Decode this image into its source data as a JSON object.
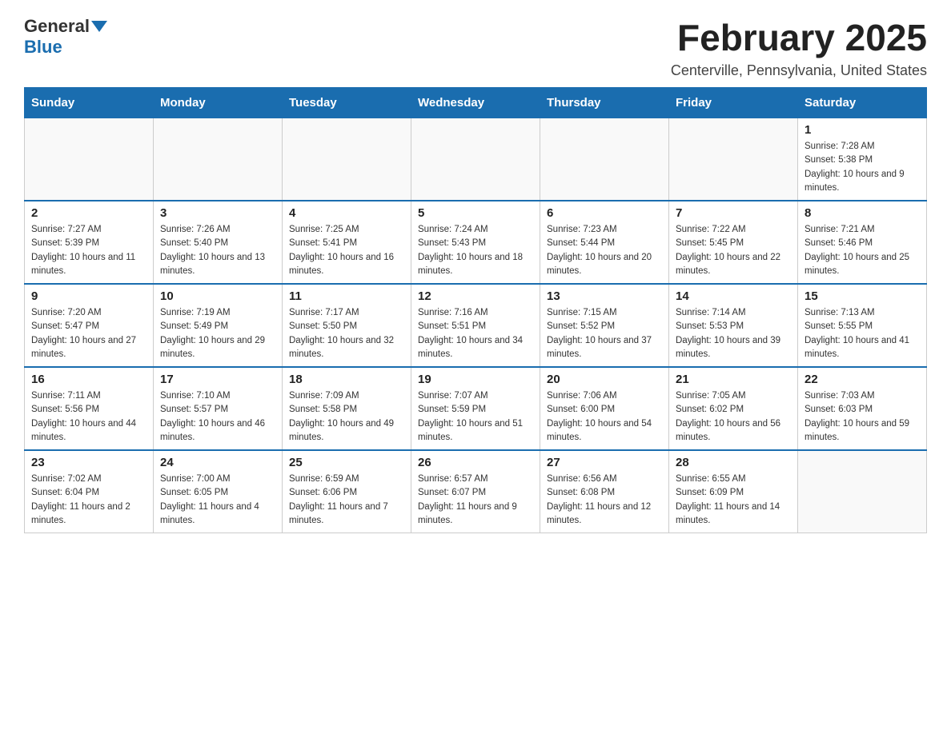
{
  "logo": {
    "general": "General",
    "blue": "Blue"
  },
  "header": {
    "month_year": "February 2025",
    "location": "Centerville, Pennsylvania, United States"
  },
  "days_of_week": [
    "Sunday",
    "Monday",
    "Tuesday",
    "Wednesday",
    "Thursday",
    "Friday",
    "Saturday"
  ],
  "weeks": [
    [
      {
        "day": "",
        "info": ""
      },
      {
        "day": "",
        "info": ""
      },
      {
        "day": "",
        "info": ""
      },
      {
        "day": "",
        "info": ""
      },
      {
        "day": "",
        "info": ""
      },
      {
        "day": "",
        "info": ""
      },
      {
        "day": "1",
        "info": "Sunrise: 7:28 AM\nSunset: 5:38 PM\nDaylight: 10 hours and 9 minutes."
      }
    ],
    [
      {
        "day": "2",
        "info": "Sunrise: 7:27 AM\nSunset: 5:39 PM\nDaylight: 10 hours and 11 minutes."
      },
      {
        "day": "3",
        "info": "Sunrise: 7:26 AM\nSunset: 5:40 PM\nDaylight: 10 hours and 13 minutes."
      },
      {
        "day": "4",
        "info": "Sunrise: 7:25 AM\nSunset: 5:41 PM\nDaylight: 10 hours and 16 minutes."
      },
      {
        "day": "5",
        "info": "Sunrise: 7:24 AM\nSunset: 5:43 PM\nDaylight: 10 hours and 18 minutes."
      },
      {
        "day": "6",
        "info": "Sunrise: 7:23 AM\nSunset: 5:44 PM\nDaylight: 10 hours and 20 minutes."
      },
      {
        "day": "7",
        "info": "Sunrise: 7:22 AM\nSunset: 5:45 PM\nDaylight: 10 hours and 22 minutes."
      },
      {
        "day": "8",
        "info": "Sunrise: 7:21 AM\nSunset: 5:46 PM\nDaylight: 10 hours and 25 minutes."
      }
    ],
    [
      {
        "day": "9",
        "info": "Sunrise: 7:20 AM\nSunset: 5:47 PM\nDaylight: 10 hours and 27 minutes."
      },
      {
        "day": "10",
        "info": "Sunrise: 7:19 AM\nSunset: 5:49 PM\nDaylight: 10 hours and 29 minutes."
      },
      {
        "day": "11",
        "info": "Sunrise: 7:17 AM\nSunset: 5:50 PM\nDaylight: 10 hours and 32 minutes."
      },
      {
        "day": "12",
        "info": "Sunrise: 7:16 AM\nSunset: 5:51 PM\nDaylight: 10 hours and 34 minutes."
      },
      {
        "day": "13",
        "info": "Sunrise: 7:15 AM\nSunset: 5:52 PM\nDaylight: 10 hours and 37 minutes."
      },
      {
        "day": "14",
        "info": "Sunrise: 7:14 AM\nSunset: 5:53 PM\nDaylight: 10 hours and 39 minutes."
      },
      {
        "day": "15",
        "info": "Sunrise: 7:13 AM\nSunset: 5:55 PM\nDaylight: 10 hours and 41 minutes."
      }
    ],
    [
      {
        "day": "16",
        "info": "Sunrise: 7:11 AM\nSunset: 5:56 PM\nDaylight: 10 hours and 44 minutes."
      },
      {
        "day": "17",
        "info": "Sunrise: 7:10 AM\nSunset: 5:57 PM\nDaylight: 10 hours and 46 minutes."
      },
      {
        "day": "18",
        "info": "Sunrise: 7:09 AM\nSunset: 5:58 PM\nDaylight: 10 hours and 49 minutes."
      },
      {
        "day": "19",
        "info": "Sunrise: 7:07 AM\nSunset: 5:59 PM\nDaylight: 10 hours and 51 minutes."
      },
      {
        "day": "20",
        "info": "Sunrise: 7:06 AM\nSunset: 6:00 PM\nDaylight: 10 hours and 54 minutes."
      },
      {
        "day": "21",
        "info": "Sunrise: 7:05 AM\nSunset: 6:02 PM\nDaylight: 10 hours and 56 minutes."
      },
      {
        "day": "22",
        "info": "Sunrise: 7:03 AM\nSunset: 6:03 PM\nDaylight: 10 hours and 59 minutes."
      }
    ],
    [
      {
        "day": "23",
        "info": "Sunrise: 7:02 AM\nSunset: 6:04 PM\nDaylight: 11 hours and 2 minutes."
      },
      {
        "day": "24",
        "info": "Sunrise: 7:00 AM\nSunset: 6:05 PM\nDaylight: 11 hours and 4 minutes."
      },
      {
        "day": "25",
        "info": "Sunrise: 6:59 AM\nSunset: 6:06 PM\nDaylight: 11 hours and 7 minutes."
      },
      {
        "day": "26",
        "info": "Sunrise: 6:57 AM\nSunset: 6:07 PM\nDaylight: 11 hours and 9 minutes."
      },
      {
        "day": "27",
        "info": "Sunrise: 6:56 AM\nSunset: 6:08 PM\nDaylight: 11 hours and 12 minutes."
      },
      {
        "day": "28",
        "info": "Sunrise: 6:55 AM\nSunset: 6:09 PM\nDaylight: 11 hours and 14 minutes."
      },
      {
        "day": "",
        "info": ""
      }
    ]
  ]
}
